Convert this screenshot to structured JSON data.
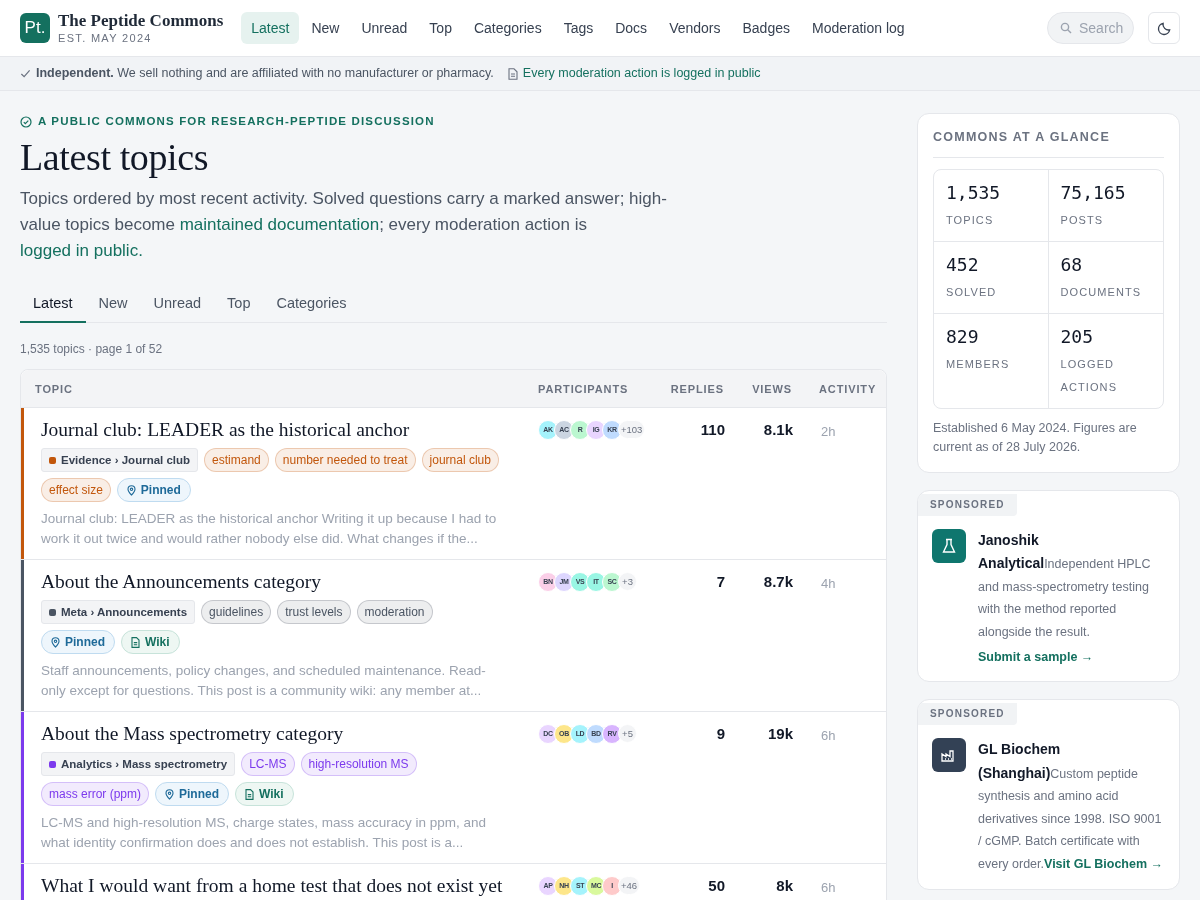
{
  "brand": {
    "logo": "Pt.",
    "name": "The Peptide Commons",
    "est": "EST. MAY 2024"
  },
  "nav": [
    {
      "label": "Latest",
      "selected": true
    },
    {
      "label": "New",
      "selected": false
    },
    {
      "label": "Unread",
      "selected": false
    },
    {
      "label": "Top",
      "selected": false
    },
    {
      "label": "Categories",
      "selected": false
    },
    {
      "label": "Tags",
      "selected": false
    },
    {
      "label": "Docs",
      "selected": false
    },
    {
      "label": "Vendors",
      "selected": false
    },
    {
      "label": "Badges",
      "selected": false
    },
    {
      "label": "Moderation log",
      "selected": false
    }
  ],
  "search": {
    "placeholder": "Search"
  },
  "banner": {
    "notice": "**Independent.** We sell nothing and are affiliated with no manufacturer or pharmacy.",
    "link": "Every moderation action is logged in public"
  },
  "eyebrow": "A PUBLIC COMMONS FOR RESEARCH-PEPTIDE DISCUSSION",
  "heading": "Latest topics",
  "intro": {
    "before": "Topics ordered by most recent activity. Solved questions carry a marked answer; high-value topics become ",
    "link1": "maintained documentation",
    "middle": "; every moderation action is ",
    "link2": "logged in public."
  },
  "tabs": [
    {
      "label": "Latest",
      "selected": true
    },
    {
      "label": "New",
      "selected": false
    },
    {
      "label": "Unread",
      "selected": false
    },
    {
      "label": "Top",
      "selected": false
    },
    {
      "label": "Categories",
      "selected": false
    }
  ],
  "count": "1,535 topics · page 1 of 52",
  "table": {
    "columns": [
      "TOPIC",
      "PARTICIPANTS",
      "REPLIES",
      "VIEWS",
      "ACTIVITY"
    ],
    "rows": [
      {
        "title": "Journal club: LEADER as the historical anchor",
        "color": "#c2570c",
        "category": "Evidence › Journal club",
        "tags": [
          {
            "kind": "tag",
            "label": "estimand"
          },
          {
            "kind": "tag",
            "label": "number needed to treat"
          },
          {
            "kind": "tag",
            "label": "journal club"
          },
          {
            "kind": "tag",
            "label": "effect size"
          },
          {
            "kind": "pinned",
            "label": "Pinned"
          }
        ],
        "excerpt": "Journal club: LEADER as the historical anchor Writing it up because I had to work it out twice and would rather nobody else did. What changes if the...",
        "participants": [
          {
            "initials": "AK",
            "color": "#a5f3fc"
          },
          {
            "initials": "AC",
            "color": "#cbd5e1"
          },
          {
            "initials": "R",
            "color": "#bbf7d0"
          },
          {
            "initials": "IG",
            "color": "#e9d5ff"
          },
          {
            "initials": "KR",
            "color": "#bfdbfe"
          }
        ],
        "more": "+103",
        "replies": "110",
        "views": "8.1k",
        "activity": "2h"
      },
      {
        "title": "About the Announcements category",
        "color": "#4b5563",
        "category": "Meta › Announcements",
        "tags": [
          {
            "kind": "tag",
            "label": "guidelines"
          },
          {
            "kind": "tag",
            "label": "trust levels"
          },
          {
            "kind": "tag",
            "label": "moderation"
          },
          {
            "kind": "pinned",
            "label": "Pinned"
          },
          {
            "kind": "wiki",
            "label": "Wiki"
          }
        ],
        "excerpt": "Staff announcements, policy changes, and scheduled maintenance. Read-only except for questions. This post is a community wiki: any member at...",
        "participants": [
          {
            "initials": "BN",
            "color": "#fbcfe8"
          },
          {
            "initials": "JM",
            "color": "#ddd6fe"
          },
          {
            "initials": "VS",
            "color": "#99f6e4"
          },
          {
            "initials": "IT",
            "color": "#99f6e4"
          },
          {
            "initials": "SC",
            "color": "#bbf7d0"
          }
        ],
        "more": "+3",
        "replies": "7",
        "views": "8.7k",
        "activity": "4h"
      },
      {
        "title": "About the Mass spectrometry category",
        "color": "#7c3aed",
        "category": "Analytics › Mass spectrometry",
        "tags": [
          {
            "kind": "tag",
            "label": "LC-MS"
          },
          {
            "kind": "tag",
            "label": "high-resolution MS"
          },
          {
            "kind": "tag",
            "label": "mass error (ppm)"
          },
          {
            "kind": "pinned",
            "label": "Pinned"
          },
          {
            "kind": "wiki",
            "label": "Wiki"
          }
        ],
        "excerpt": "LC-MS and high-resolution MS, charge states, mass accuracy in ppm, and what identity confirmation does and does not establish. This post is a...",
        "participants": [
          {
            "initials": "DC",
            "color": "#e9d5ff"
          },
          {
            "initials": "OB",
            "color": "#fde68a"
          },
          {
            "initials": "LD",
            "color": "#a5f3fc"
          },
          {
            "initials": "BD",
            "color": "#bfdbfe"
          },
          {
            "initials": "RV",
            "color": "#d8b4fe"
          }
        ],
        "more": "+5",
        "replies": "9",
        "views": "19k",
        "activity": "6h"
      },
      {
        "title": "What I would want from a home test that does not exist yet",
        "color": "#7c3aed",
        "participants": [
          {
            "initials": "AP",
            "color": "#e9d5ff"
          },
          {
            "initials": "NH",
            "color": "#fde68a"
          },
          {
            "initials": "ST",
            "color": "#a5f3fc"
          },
          {
            "initials": "MC",
            "color": "#d9f99d"
          },
          {
            "initials": "I",
            "color": "#fecaca"
          }
        ],
        "more": "+46",
        "replies": "50",
        "views": "8k",
        "activity": "6h"
      }
    ]
  },
  "glance": {
    "title": "COMMONS AT A GLANCE",
    "stats": [
      {
        "value": "1,535",
        "label": "TOPICS"
      },
      {
        "value": "75,165",
        "label": "POSTS"
      },
      {
        "value": "452",
        "label": "SOLVED"
      },
      {
        "value": "68",
        "label": "DOCUMENTS"
      },
      {
        "value": "829",
        "label": "MEMBERS"
      },
      {
        "value": "205",
        "label": "LOGGED ACTIONS"
      }
    ],
    "note": "Established 6 May 2024. Figures are current as of 28 July 2026."
  },
  "sponsors": [
    {
      "badge": "SPONSORED",
      "kind": "lab",
      "color": "#0f766e",
      "text": "**Janoshik Analytical**Independent HPLC and mass-spectrometry testing with the method reported alongside the result.",
      "link": "Submit a sample →",
      "link_on_own_line": true
    },
    {
      "badge": "SPONSORED",
      "kind": "factory",
      "color": "#334155",
      "text": "**GL Biochem (Shanghai)**Custom peptide synthesis and amino acid derivatives since 1998. ISO 9001 / cGMP. Batch certificate with every order.",
      "link": "Visit GL Biochem →",
      "link_on_own_line": false
    }
  ]
}
